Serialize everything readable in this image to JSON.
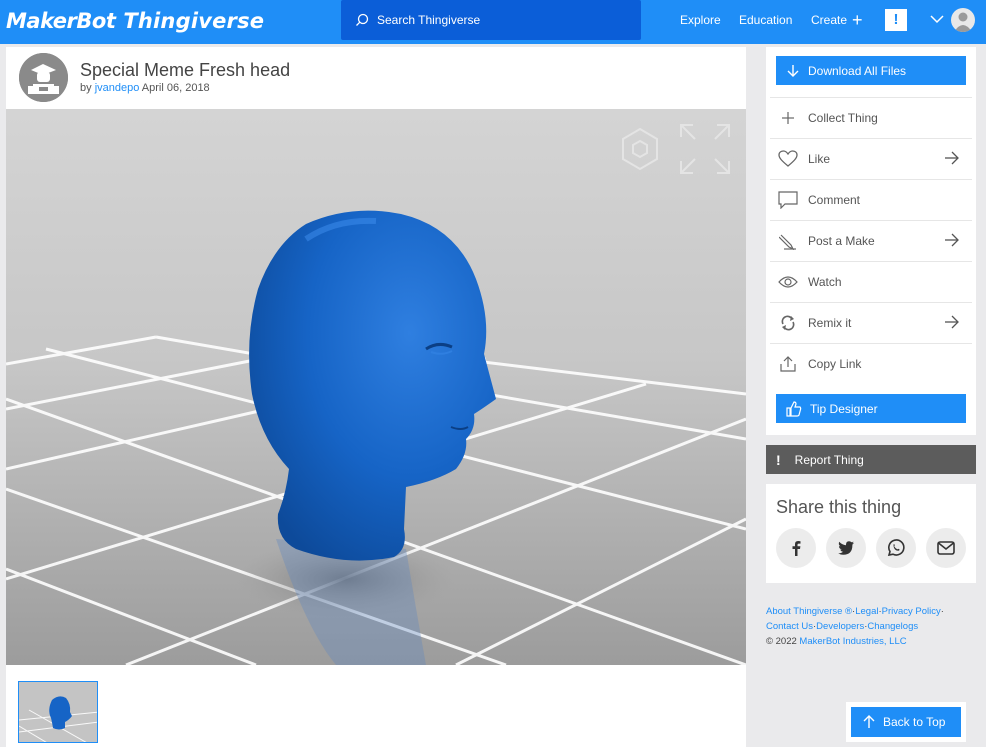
{
  "topbar": {
    "logo_brand": "MakerBot",
    "logo_product": "Thingiverse",
    "search_placeholder": "Search Thingiverse",
    "nav": {
      "explore": "Explore",
      "education": "Education",
      "create": "Create",
      "alert": "!"
    }
  },
  "thing": {
    "title": "Special Meme Fresh head",
    "by": "by",
    "author": "jvandepo",
    "date": "April 06, 2018"
  },
  "actions": {
    "download": "Download All Files",
    "collect": "Collect Thing",
    "like": "Like",
    "comment": "Comment",
    "post_make": "Post a Make",
    "watch": "Watch",
    "remix": "Remix it",
    "copy_link": "Copy Link",
    "tip": "Tip Designer",
    "report": "Report Thing",
    "report_icon": "!"
  },
  "share": {
    "title": "Share this thing",
    "icons": [
      "facebook-icon",
      "twitter-icon",
      "whatsapp-icon",
      "email-icon"
    ]
  },
  "footer": {
    "about": "About Thingiverse ®",
    "legal": "Legal",
    "privacy": "Privacy Policy",
    "contact": "Contact Us",
    "developers": "Developers",
    "changelogs": "Changelogs",
    "copyright": "©  2022 ",
    "company": "MakerBot Industries, LLC"
  },
  "back_to_top": "Back to Top",
  "colors": {
    "accent": "#1f8ef7",
    "model": "#1565c8",
    "report": "#5c5c5c"
  }
}
